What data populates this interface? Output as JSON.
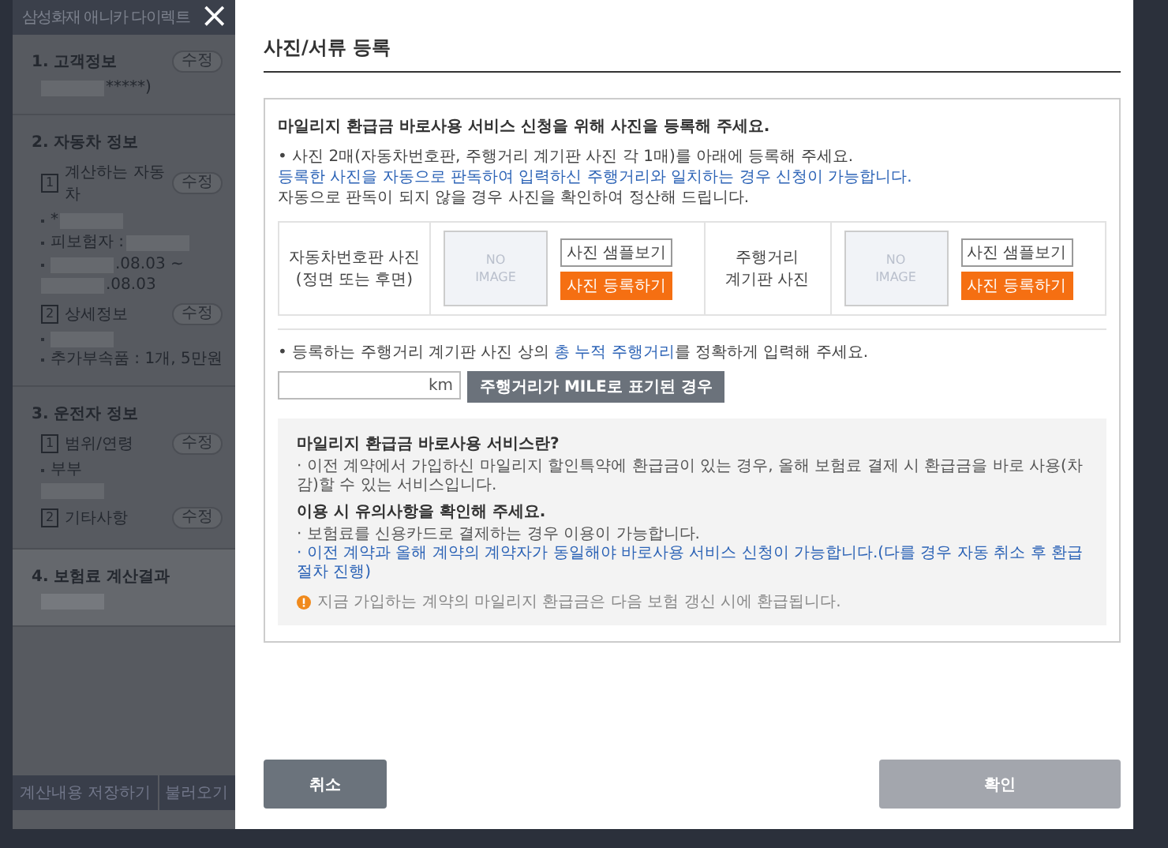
{
  "background_page": {
    "title": "삼성화재 애니카 다이렉트",
    "close_label": "×",
    "sections": [
      {
        "heading": "1. 고객정보",
        "edit_label": "수정",
        "highlighted": false,
        "lines": [
          [
            {
              "kind": "mask"
            },
            {
              "kind": "text",
              "text": "*****)"
            }
          ]
        ]
      },
      {
        "heading": "2. 자동차 정보",
        "highlighted": false,
        "subsections": [
          {
            "number": "1",
            "title": "계산하는 자동차",
            "edit_label": "수정",
            "lines": [
              [
                {
                  "kind": "dot"
                },
                {
                  "kind": "text",
                  "text": "*"
                },
                {
                  "kind": "mask"
                }
              ],
              [
                {
                  "kind": "dot"
                },
                {
                  "kind": "text",
                  "text": "피보험자 :"
                },
                {
                  "kind": "mask"
                }
              ],
              [
                {
                  "kind": "dot"
                },
                {
                  "kind": "mask"
                },
                {
                  "kind": "text",
                  "text": ".08.03 ~"
                },
                {
                  "kind": "mask"
                },
                {
                  "kind": "text",
                  "text": ".08.03"
                }
              ]
            ]
          },
          {
            "number": "2",
            "title": "상세정보",
            "edit_label": "수정",
            "lines": [
              [
                {
                  "kind": "dot"
                },
                {
                  "kind": "mask"
                }
              ],
              [
                {
                  "kind": "dot"
                },
                {
                  "kind": "text",
                  "text": "추가부속품 : 1개, 5만원"
                }
              ]
            ]
          }
        ]
      },
      {
        "heading": "3. 운전자 정보",
        "highlighted": false,
        "subsections": [
          {
            "number": "1",
            "title": "범위/연령",
            "edit_label": "수정",
            "lines": [
              [
                {
                  "kind": "dot"
                },
                {
                  "kind": "text",
                  "text": "부부"
                }
              ],
              [
                {
                  "kind": "mask"
                }
              ]
            ]
          },
          {
            "number": "2",
            "title": "기타사항",
            "edit_label": "수정"
          }
        ]
      },
      {
        "heading": "4. 보험료 계산결과",
        "highlighted": true,
        "lines": [
          [
            {
              "kind": "mask"
            }
          ]
        ]
      }
    ],
    "buttons": [
      "계산내용 저장하기",
      "불러오기"
    ]
  },
  "modal": {
    "title": "사진/서류 등록",
    "heading": "마일리지 환급금 바로사용 서비스 신청을 위해 사진을 등록해 주세요.",
    "intro": [
      {
        "kind": "plain",
        "text": "• 사진 2매(자동차번호판, 주행거리 계기판 사진 각 1매)를 아래에 등록해 주세요."
      },
      {
        "kind": "blue",
        "text": "등록한 사진을 자동으로 판독하여 입력하신 주행거리와 일치하는 경우 신청이 가능합니다."
      },
      {
        "kind": "plain",
        "text": "자동으로 판독이 되지 않을 경우 사진을 확인하여 정산해 드립니다."
      }
    ],
    "photo_slots": [
      {
        "label": [
          "자동차번호판 사진",
          "(정면 또는 후면)"
        ],
        "placeholder": "NO IMAGE",
        "sample_button": "사진 샘플보기",
        "upload_button": "사진 등록하기"
      },
      {
        "label": [
          "주행거리",
          "계기판 사진"
        ],
        "placeholder": "NO IMAGE",
        "sample_button": "사진 샘플보기",
        "upload_button": "사진 등록하기"
      }
    ],
    "mileage_prompt": [
      {
        "kind": "plain",
        "text": "• 등록하는 주행거리 계기판 사진 상의 "
      },
      {
        "kind": "blue",
        "text": "총 누적 주행거리"
      },
      {
        "kind": "plain",
        "text": "를 정확하게 입력해 주세요."
      }
    ],
    "mileage_field": {
      "unit": "km"
    },
    "mile_button": "주행거리가 MILE로 표기된 경우",
    "info": [
      {
        "kind": "heading",
        "text": "마일리지 환급금 바로사용 서비스란?"
      },
      {
        "kind": "plain",
        "text": "· 이전 계약에서 가입하신 마일리지 할인특약에 환급금이 있는 경우, 올해 보험료 결제 시 환급금을 바로 사용(차감)할 수 있는 서비스입니다."
      },
      {
        "kind": "heading",
        "text": "이용 시 유의사항을 확인해 주세요."
      },
      {
        "kind": "plain",
        "text": "· 보험료를 신용카드로 결제하는 경우 이용이 가능합니다."
      },
      {
        "kind": "blue",
        "text": "· 이전 계약과 올해 계약의 계약자가 동일해야 바로사용 서비스 신청이 가능합니다.(다를 경우 자동 취소 후 환급절차 진행)"
      },
      {
        "kind": "warning",
        "text": "지금 가입하는 계약의 마일리지 환급금은 다음 보험 갱신 시에 환급됩니다."
      }
    ],
    "cancel_button": {
      "label": "취소",
      "disabled": false
    },
    "confirm_button": {
      "label": "확인",
      "disabled": true
    }
  }
}
